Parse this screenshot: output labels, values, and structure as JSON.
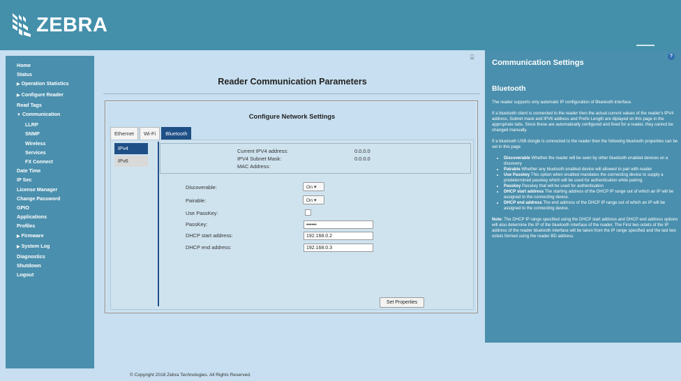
{
  "brand": {
    "name": "ZEBRA"
  },
  "sidebar": {
    "items": [
      {
        "label": "Home",
        "sub": false,
        "caret": ""
      },
      {
        "label": "Status",
        "sub": false,
        "caret": ""
      },
      {
        "label": "Operation Statistics",
        "sub": false,
        "caret": "▶"
      },
      {
        "label": "Configure Reader",
        "sub": false,
        "caret": "▶"
      },
      {
        "label": "Read Tags",
        "sub": false,
        "caret": ""
      },
      {
        "label": "Communication",
        "sub": false,
        "caret": "▼"
      },
      {
        "label": "LLRP",
        "sub": true,
        "caret": ""
      },
      {
        "label": "SNMP",
        "sub": true,
        "caret": ""
      },
      {
        "label": "Wireless",
        "sub": true,
        "caret": ""
      },
      {
        "label": "Services",
        "sub": true,
        "caret": ""
      },
      {
        "label": "FX Connect",
        "sub": true,
        "caret": ""
      },
      {
        "label": "Date Time",
        "sub": false,
        "caret": ""
      },
      {
        "label": "IP Sec",
        "sub": false,
        "caret": ""
      },
      {
        "label": "License Manager",
        "sub": false,
        "caret": ""
      },
      {
        "label": "Change Password",
        "sub": false,
        "caret": ""
      },
      {
        "label": "GPIO",
        "sub": false,
        "caret": ""
      },
      {
        "label": "Applications",
        "sub": false,
        "caret": ""
      },
      {
        "label": "Profiles",
        "sub": false,
        "caret": ""
      },
      {
        "label": "Firmware",
        "sub": false,
        "caret": "▶"
      },
      {
        "label": "System Log",
        "sub": false,
        "caret": "▶"
      },
      {
        "label": "Diagnostics",
        "sub": false,
        "caret": ""
      },
      {
        "label": "Shutdown",
        "sub": false,
        "caret": ""
      },
      {
        "label": "Logout",
        "sub": false,
        "caret": ""
      }
    ]
  },
  "main": {
    "title": "Reader Communication Parameters",
    "panel_title": "Configure Network Settings",
    "tabs": [
      "Ethernet",
      "Wi-Fi",
      "Bluetooth"
    ],
    "active_tab": "Bluetooth",
    "subtabs": [
      "IPv4",
      "IPv6"
    ],
    "info": {
      "current_ipv4_label": "Current IPV4 address:",
      "current_ipv4_value": "0.0.0.0",
      "subnet_label": "IPV4 Subnet Mask:",
      "subnet_value": "0.0.0.0",
      "mac_label": "MAC Address:"
    },
    "form": {
      "discoverable_label": "Discoverable:",
      "discoverable_value": "On",
      "pairable_label": "Pairable:",
      "pairable_value": "On",
      "use_passkey_label": "Use PassKey:",
      "passkey_label": "PassKey:",
      "passkey_value": "••••••",
      "dhcp_start_label": "DHCP start address:",
      "dhcp_start_value": "192.168.0.2",
      "dhcp_end_label": "DHCP end address:",
      "dhcp_end_value": "192.168.0.3"
    },
    "set_button": "Set Properties",
    "footer": "© Copyright 2018 Zebra Technologies. All Rights Reserved."
  },
  "help": {
    "title": "Communication Settings",
    "subtitle": "Bluetooth",
    "p1": "The reader supports only automatic IP configuration of Bluetooth interface.",
    "p2": "If a bluetooth client is connected to the reader then the actual current values of the reader's IPV4 address, Subnet mask and IPV6 address and Prefix Length are diplayed on this page in the appropriate tabs. Since these are automatically configured and fixed for a reader, they cannot be changed manually.",
    "p3": "If a bluetooth USB dongle is connected to the reader then the following bluetooth properties can be set in this page",
    "bullets": [
      {
        "term": "Discoverable",
        "text": " Whether the reader will be seen by other bluetooth enabled devices on a discovery"
      },
      {
        "term": "Pairable",
        "text": " Whether any bluetooth enabled device will allowed to pair with reader"
      },
      {
        "term": "Use Passkey",
        "text": " This option when enabled mandates the connecting device to supply a predetermined passkey which will be used for authentication while pairing."
      },
      {
        "term": "Passkey",
        "text": " Passkey that will be used for authentication"
      },
      {
        "term": "DHCP start address",
        "text": " The starting address of the DHCP IP range out of which an IP will be assigned to the connecting device."
      },
      {
        "term": "DHCP end address",
        "text": " The end address of the DHCP IP range out of which an IP will be assigned to the connecting device."
      }
    ],
    "note_label": "Note:",
    "note_text": " The DHCP IP range specified using the DHCP start address and DHCP end address options will also determine the IP of the bluetooth interface of the reader. The First two octets of the IP address of the reader bluetooth interface will be taken from the IP range specified and the last two octets formed using the reader BD address."
  },
  "colors": {
    "header": "#4490ab",
    "sidebar": "#4a8fad",
    "page_bg": "#c7dff0",
    "tab_active": "#1e4f86"
  },
  "icons": {
    "print": "print-icon",
    "help": "help-icon",
    "logo": "zebra-head-logo"
  }
}
